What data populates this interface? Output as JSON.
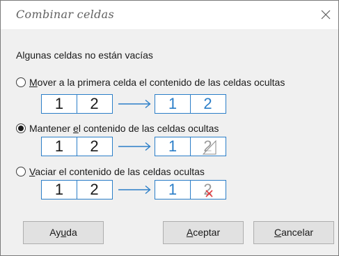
{
  "dialog": {
    "title": "Combinar celdas",
    "close_icon": "close-icon"
  },
  "intro": "Algunas celdas no están vacías",
  "options": [
    {
      "mnemonic": "M",
      "label_rest": "over a la primera celda el contenido de las celdas ocultas",
      "selected": false,
      "before": [
        "1",
        "2"
      ],
      "after": [
        "1",
        "2"
      ]
    },
    {
      "label_pre": "Mantener ",
      "mnemonic": "e",
      "label_rest": "l contenido de las celdas ocultas",
      "selected": true,
      "before": [
        "1",
        "2"
      ],
      "after": [
        "1",
        "2"
      ]
    },
    {
      "mnemonic": "V",
      "label_rest": "aciar el contenido de las celdas ocultas",
      "selected": false,
      "before": [
        "1",
        "2"
      ],
      "after": [
        "1",
        "2"
      ]
    }
  ],
  "buttons": {
    "help": {
      "pre": "Ay",
      "mnemonic": "u",
      "rest": "da"
    },
    "ok": {
      "pre": "",
      "mnemonic": "A",
      "rest": "ceptar"
    },
    "cancel": {
      "pre": "",
      "mnemonic": "C",
      "rest": "ancelar"
    }
  },
  "colors": {
    "accent": "#2b7ec8",
    "delete_mark": "#e0393e"
  }
}
